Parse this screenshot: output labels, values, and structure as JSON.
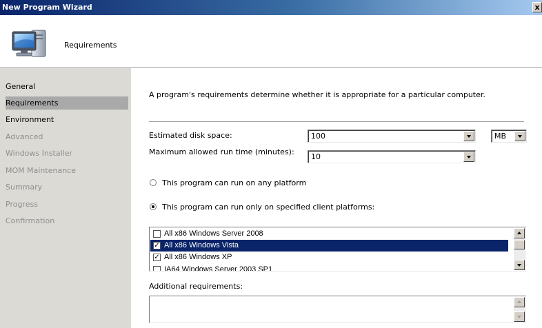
{
  "window": {
    "title": "New Program Wizard",
    "close_glyph": "x"
  },
  "header": {
    "title": "Requirements",
    "icon": "computer-icon"
  },
  "sidebar": {
    "items": [
      {
        "label": "General",
        "state": "enabled"
      },
      {
        "label": "Requirements",
        "state": "active"
      },
      {
        "label": "Environment",
        "state": "enabled"
      },
      {
        "label": "Advanced",
        "state": "disabled"
      },
      {
        "label": "Windows Installer",
        "state": "disabled"
      },
      {
        "label": "MOM Maintenance",
        "state": "disabled"
      },
      {
        "label": "Summary",
        "state": "disabled"
      },
      {
        "label": "Progress",
        "state": "disabled"
      },
      {
        "label": "Confirmation",
        "state": "disabled"
      }
    ]
  },
  "main": {
    "description": "A program's requirements determine whether it is appropriate for a particular computer.",
    "disk_space": {
      "label": "Estimated disk space:",
      "value": "100",
      "unit": "MB"
    },
    "max_runtime": {
      "label": "Maximum allowed run time (minutes):",
      "value": "10"
    },
    "radio_any": {
      "label": "This program can run on any platform",
      "checked": false
    },
    "radio_specified": {
      "label": "This program can run only on specified client platforms:",
      "checked": true
    },
    "platforms": [
      {
        "label": "All x86 Windows Server 2008",
        "checked": false,
        "selected": false
      },
      {
        "label": "All x86 Windows Vista",
        "checked": true,
        "selected": true
      },
      {
        "label": "All x86 Windows XP",
        "checked": true,
        "selected": false
      },
      {
        "label": "IA64 Windows Server 2003 SP1",
        "checked": false,
        "selected": false
      }
    ],
    "additional": {
      "label": "Additional requirements:",
      "value": ""
    }
  },
  "colors": {
    "selection": "#0a246a",
    "sidebar_bg": "#dcdad5",
    "active_item_bg": "#a9a9a9"
  }
}
